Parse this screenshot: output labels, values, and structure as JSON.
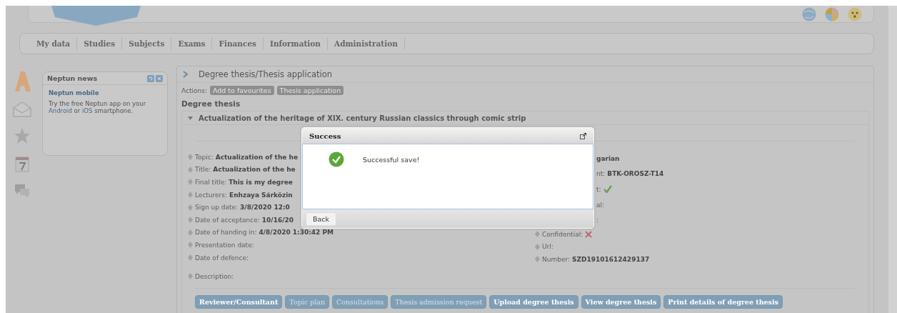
{
  "nav": {
    "items": [
      "My data",
      "Studies",
      "Subjects",
      "Exams",
      "Finances",
      "Information",
      "Administration"
    ]
  },
  "news": {
    "title": "Neptun news",
    "heading": "Neptun mobile",
    "text": [
      {
        "text": "Try the free Neptun app on your ",
        "link": false
      },
      {
        "text": "Android",
        "link": true
      },
      {
        "text": " or ",
        "link": false
      },
      {
        "text": "iOS",
        "link": true
      },
      {
        "text": " smartphone.",
        "link": false
      }
    ]
  },
  "content": {
    "title": "Degree thesis/Thesis application",
    "actions_label": "Actions:",
    "actions": [
      "Add to favourites",
      "Thesis application"
    ],
    "section_title": "Degree thesis",
    "thesis_title": "Actualization of the heritage of XIX. century Russian classics through comic strip",
    "expanded": true,
    "left_fields": [
      {
        "label": "Topic:",
        "value": "Actualization of the he"
      },
      {
        "label": "Title:",
        "value": "Actualization of the he"
      },
      {
        "label": "Final title:",
        "value": "This is my degree"
      },
      {
        "label": "Lecturers:",
        "value": "Enhzaya Sárközin"
      },
      {
        "label": "Sign up date:",
        "value": "3/8/2020 12:0"
      },
      {
        "label": "Date of acceptance:",
        "value": "10/16/20"
      },
      {
        "label": "Date of handing in:",
        "value": "4/8/2020 1:30:42 PM"
      },
      {
        "label": "Presentation date:"
      },
      {
        "label": "Date of defence:"
      }
    ],
    "description_label": "Description:",
    "right_fields": [
      {
        "value": "garian",
        "kind": "text",
        "partial": true
      },
      {
        "label": "nt:",
        "value": "BTK-OROSZ-T14",
        "kind": "text",
        "partial": true
      },
      {
        "label": "t:",
        "kind": "check",
        "partial": true
      },
      {
        "label": "al:",
        "kind": "text",
        "partial": true
      },
      {
        "label": ":",
        "kind": "text",
        "partial": true
      },
      {
        "label": "Confidential:",
        "kind": "cross",
        "partial": false
      },
      {
        "label": "Url:",
        "kind": "text",
        "partial": false
      },
      {
        "label": "Number:",
        "value": "SZD19101612429137",
        "kind": "text",
        "partial": false
      }
    ],
    "buttons": [
      {
        "label": "Reviewer/Consultant",
        "disabled": false
      },
      {
        "label": "Topic plan",
        "disabled": true
      },
      {
        "label": "Consultations",
        "disabled": true
      },
      {
        "label": "Thesis admission request",
        "disabled": true
      },
      {
        "label": "Upload degree thesis",
        "disabled": false
      },
      {
        "label": "View degree thesis",
        "disabled": false
      },
      {
        "label": "Print details of degree thesis",
        "disabled": false
      }
    ]
  },
  "dialog": {
    "title": "Success",
    "message": "Successful save!",
    "button": "Back"
  }
}
